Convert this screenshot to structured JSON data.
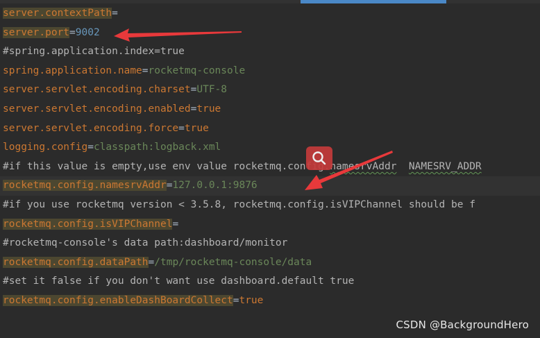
{
  "lines": [
    {
      "key": "server.contextPath",
      "eq": "=",
      "value": ""
    },
    {
      "key": "server.port",
      "eq": "=",
      "value": "9002"
    },
    {
      "comment": "#spring.application.index=true"
    },
    {
      "key": "spring.application.name",
      "eq": "=",
      "value": "rocketmq-console"
    },
    {
      "key": "server.servlet.encoding.charset",
      "eq": "=",
      "value": "UTF-8"
    },
    {
      "key": "server.servlet.encoding.enabled",
      "eq": "=",
      "value": "true"
    },
    {
      "key": "server.servlet.encoding.force",
      "eq": "=",
      "value": "true"
    },
    {
      "key": "logging.config",
      "eq": "=",
      "value": "classpath:logback.xml"
    },
    {
      "comment_a": "#if this value is empty,use env value rocketmq.config.",
      "comment_b": "namesrvAddr",
      "comment_c": "  ",
      "comment_d": "NAMESRV_ADDR"
    },
    {
      "key": "rocketmq.config.namesrvAddr",
      "eq": "=",
      "value": "127.0.0.1:9876"
    },
    {
      "comment": "#if you use rocketmq version < 3.5.8, rocketmq.config.isVIPChannel should be f"
    },
    {
      "key": "rocketmq.config.isVIPChannel",
      "eq": "=",
      "value": ""
    },
    {
      "comment": "#rocketmq-console's data path:dashboard/monitor"
    },
    {
      "key": "rocketmq.config.dataPath",
      "eq": "=",
      "value": "/tmp/rocketmq-console/data"
    },
    {
      "comment": "#set it false if you don't want use dashboard.default true"
    },
    {
      "key": "rocketmq.config.enableDashBoardCollect",
      "eq": "=",
      "value": "true"
    }
  ],
  "watermark": "CSDN @BackgroundHero",
  "colors": {
    "background": "#2b2b2b",
    "key": "#cc7832",
    "string_value": "#6a8759",
    "number_value": "#6897bb",
    "comment": "#b4b4b4",
    "annotation_arrow": "#e8393b"
  },
  "icons": {
    "search": "search-icon"
  }
}
